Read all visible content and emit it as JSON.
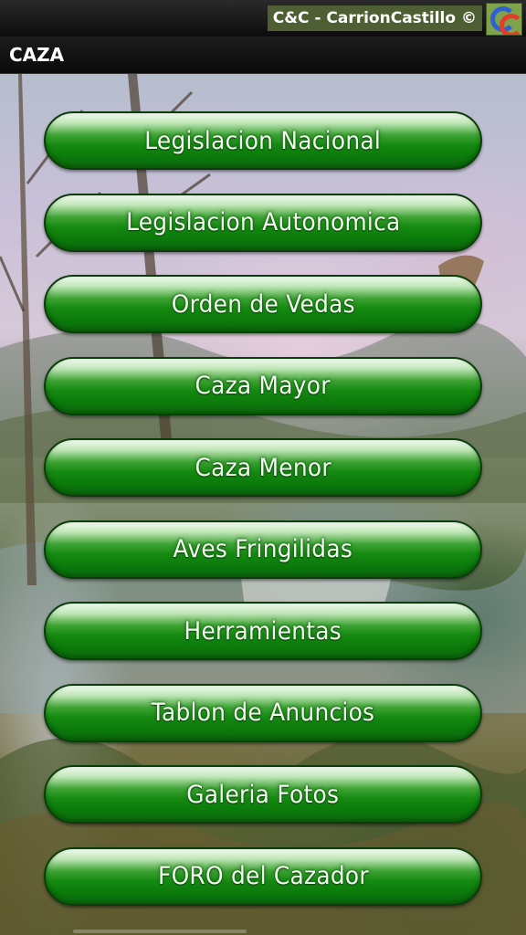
{
  "status_bar": {
    "brand_text": "C&C - CarrionCastillo ©",
    "logo_icon": "cc-logo-icon"
  },
  "app_bar": {
    "title": "CAZA"
  },
  "menu": {
    "items": [
      {
        "label": "Legislacion Nacional"
      },
      {
        "label": "Legislacion Autonomica"
      },
      {
        "label": "Orden de Vedas"
      },
      {
        "label": "Caza Mayor"
      },
      {
        "label": "Caza Menor"
      },
      {
        "label": "Aves Fringilidas"
      },
      {
        "label": "Herramientas"
      },
      {
        "label": "Tablon de Anuncios"
      },
      {
        "label": "Galeria Fotos"
      },
      {
        "label": "FORO del Cazador"
      }
    ]
  },
  "colors": {
    "button_green": "#158a11",
    "button_border": "#0b3d0b",
    "brand_bg": "#4f5f34"
  }
}
